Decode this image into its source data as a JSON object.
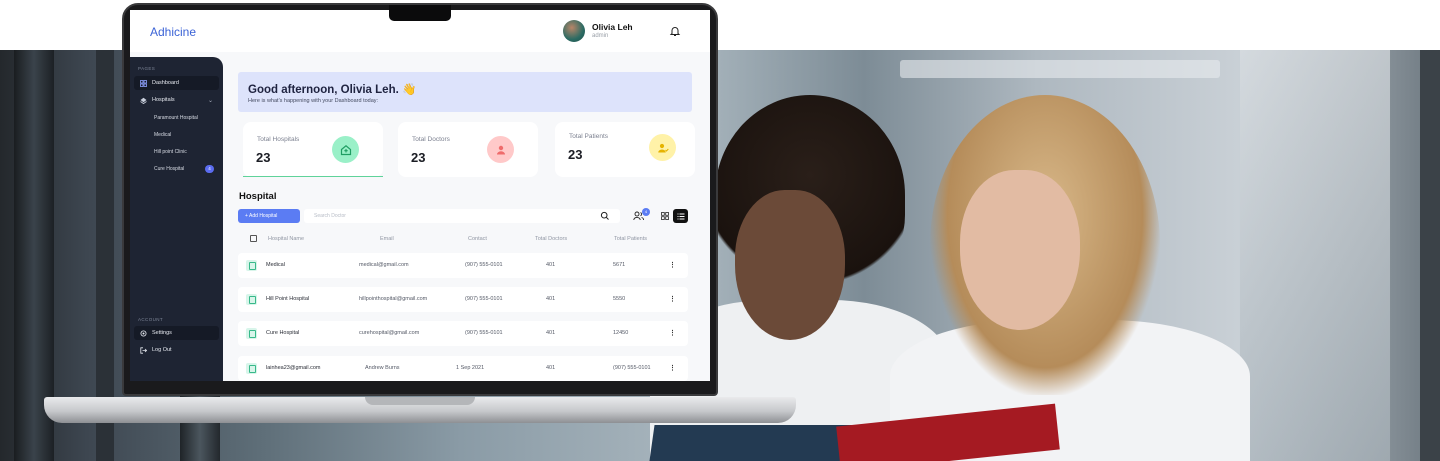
{
  "brand": "Adhicine",
  "user": {
    "name": "Olivia Leh",
    "role": "admin"
  },
  "sidebar": {
    "section_pages": "PAGES",
    "section_account": "ACCOUNT",
    "items": [
      {
        "label": "Dashboard",
        "icon": "dashboard-icon",
        "active": true
      },
      {
        "label": "Hospitals",
        "icon": "hospital-icon",
        "active": false
      }
    ],
    "sub_items": [
      {
        "label": "Paramount Hospital"
      },
      {
        "label": "Medical"
      },
      {
        "label": "Hill point Clinic"
      },
      {
        "label": "Cure Hospital",
        "badge": "4"
      }
    ],
    "settings": "Settings",
    "logout": "Log Out"
  },
  "greeting": {
    "title": "Good afternoon, Olivia Leh. 👋",
    "subtitle": "Here is what's happening with your Dashboard today:"
  },
  "stats": [
    {
      "label": "Total Hospitals",
      "value": "23",
      "color": "#9af0c8",
      "icon_color": "#2bb673"
    },
    {
      "label": "Total Doctors",
      "value": "23",
      "color": "#ffc9c9",
      "icon_color": "#ef6b6b"
    },
    {
      "label": "Total Patients",
      "value": "23",
      "color": "#fff2a8",
      "icon_color": "#e6b300"
    }
  ],
  "hospital_section": {
    "title": "Hospital",
    "add_button": "+ Add Hospital",
    "search_placeholder": "Search Doctor",
    "users_badge": "4"
  },
  "table": {
    "columns": [
      "Hospital Name",
      "Email",
      "Contact",
      "Total Doctors",
      "Total Patients"
    ],
    "rows": [
      {
        "name": "Medical",
        "email": "medical@gmail.com",
        "contact": "(907) 555-0101",
        "doctors": "401",
        "patients": "5671"
      },
      {
        "name": "Hill Point  Hospital",
        "email": "hillpointhospital@gmail.com",
        "contact": "(907) 555-0101",
        "doctors": "401",
        "patients": "5550"
      },
      {
        "name": "Cure Hospital",
        "email": "curehospital@gmail.com",
        "contact": "(907) 555-0101",
        "doctors": "401",
        "patients": "12450"
      },
      {
        "name": "lainhea23@gmail.com",
        "email": "Andrew Burns",
        "contact": "1 Sep 2021",
        "doctors": "401",
        "patients": "(907) 555-0101"
      }
    ]
  }
}
